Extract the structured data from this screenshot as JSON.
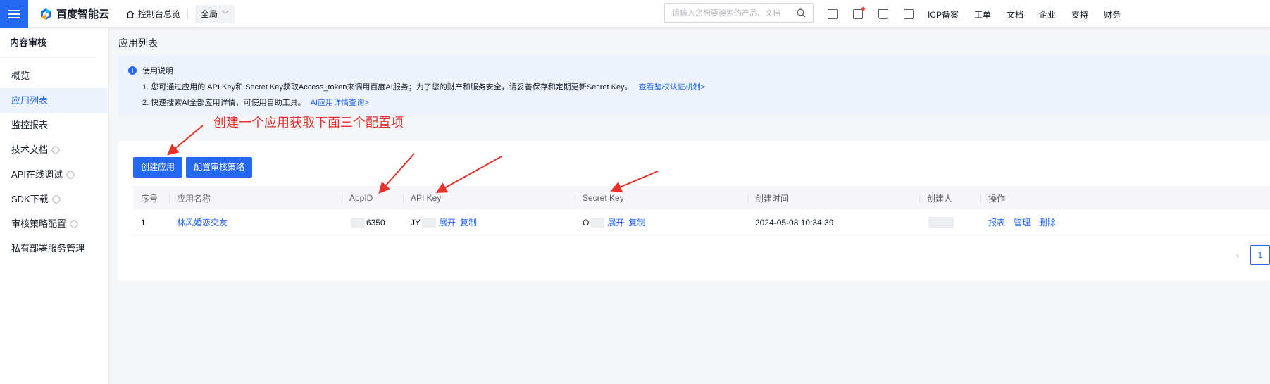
{
  "topbar": {
    "logo_text": "百度智能云",
    "console_label": "控制台总览",
    "region_label": "全局",
    "search_placeholder": "请输入您想要搜索的产品、文档",
    "icons": [
      "qrcode-icon",
      "message-icon",
      "cart-icon",
      "bn-icon"
    ],
    "links": [
      "ICP备案",
      "工单",
      "文档",
      "企业",
      "支持",
      "财务"
    ]
  },
  "sidebar": {
    "title": "内容审核",
    "items": [
      {
        "label": "概览",
        "external": false
      },
      {
        "label": "应用列表",
        "external": false,
        "active": true
      },
      {
        "label": "监控报表",
        "external": false
      },
      {
        "label": "技术文档",
        "external": true
      },
      {
        "label": "API在线调试",
        "external": true
      },
      {
        "label": "SDK下载",
        "external": true
      },
      {
        "label": "审核策略配置",
        "external": true
      },
      {
        "label": "私有部署服务管理",
        "external": false
      }
    ]
  },
  "main": {
    "page_title": "应用列表",
    "notice": {
      "title": "使用说明",
      "line1_text": "1. 您可通过应用的 API Key和 Secret Key获取Access_token来调用百度AI服务；为了您的财产和服务安全，请妥善保存和定期更新Secret Key。",
      "line1_link": "查看鉴权认证机制>",
      "line2_text": "2. 快速搜索AI全部应用详情，可使用自助工具。",
      "line2_link": "AI应用详情查询>"
    },
    "annotation": "创建一个应用获取下面三个配置项",
    "buttons": {
      "create": "创建应用",
      "configure": "配置审核策略"
    },
    "table": {
      "headers": [
        "序号",
        "应用名称",
        "AppID",
        "API Key",
        "Secret Key",
        "创建时间",
        "创建人",
        "操作"
      ],
      "row": {
        "index": "1",
        "name": "林风婚恋交友",
        "appid_prefix": "",
        "appid_suffix": "6350",
        "api_key_prefix": "JY",
        "secret_key_prefix": "O",
        "expand": "展开",
        "copy": "复制",
        "created": "2024-05-08 10:34:39",
        "creator": "",
        "actions": [
          "报表",
          "管理",
          "删除"
        ]
      }
    },
    "pagination": {
      "current": "1"
    }
  },
  "colors": {
    "primary": "#2468f2",
    "annotation": "#e8312b",
    "notice_bg": "#eef3fe"
  }
}
